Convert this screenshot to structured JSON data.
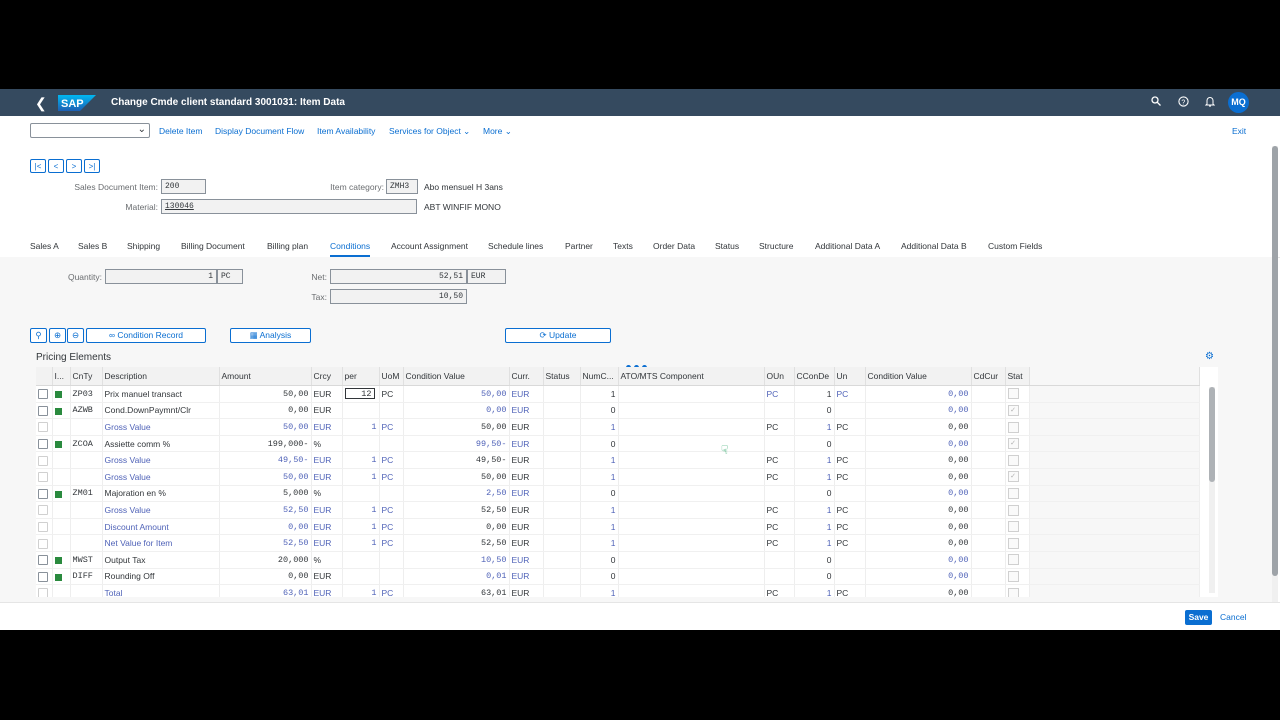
{
  "shell": {
    "logo_text": "SAP",
    "title": "Change Cmde client standard 3001031: Item Data",
    "avatar": "MQ",
    "icons": [
      "back-icon",
      "search-icon",
      "help-icon",
      "notifications-icon"
    ]
  },
  "toolbar": {
    "variant_value": "",
    "links": [
      "Delete Item",
      "Display Document Flow",
      "Item Availability",
      "Services for Object",
      "More"
    ],
    "exit": "Exit"
  },
  "nav_buttons": [
    "|<",
    "<",
    ">",
    ">|"
  ],
  "header": {
    "sales_doc_item_label": "Sales Document Item:",
    "sales_doc_item_value": "200",
    "item_category_label": "Item category:",
    "item_category_value": "ZMH3",
    "item_category_text": "Abo mensuel H 3ans",
    "material_label": "Material:",
    "material_value": "130046",
    "material_text": "ABT WINFIF MONO"
  },
  "tabs": [
    "Sales A",
    "Sales B",
    "Shipping",
    "Billing Document",
    "Billing plan",
    "Conditions",
    "Account Assignment",
    "Schedule lines",
    "Partner",
    "Texts",
    "Order Data",
    "Status",
    "Structure",
    "Additional Data A",
    "Additional Data B",
    "Custom Fields"
  ],
  "active_tab": "Conditions",
  "conditions": {
    "quantity_label": "Quantity:",
    "quantity_value": "1",
    "quantity_unit": "PC",
    "net_label": "Net:",
    "net_value": "52,51",
    "net_currency": "EUR",
    "tax_label": "Tax:",
    "tax_value": "10,50",
    "buttons": {
      "condition_record": "Condition Record",
      "analysis": "Analysis",
      "update": "Update"
    }
  },
  "pricing": {
    "title": "Pricing Elements",
    "columns": [
      "I...",
      "CnTy",
      "Description",
      "Amount",
      "Crcy",
      "per",
      "UoM",
      "Condition Value",
      "Curr.",
      "Status",
      "NumC...",
      "ATO/MTS Component",
      "OUn",
      "CConDe",
      "Un",
      "Condition Value",
      "CdCur",
      "Stat"
    ],
    "rows": [
      {
        "active": true,
        "cnty": "ZP03",
        "desc": "Prix manuel transact",
        "amount": "50,00",
        "crcy": "EUR",
        "per": "12",
        "uom": "PC",
        "cval": "50,00",
        "curr": "EUR",
        "numc": "1",
        "oun": "PC",
        "ccon": "1",
        "un": "PC",
        "cval2": "0,00",
        "stat": false,
        "sub": false
      },
      {
        "active": true,
        "cnty": "AZWB",
        "desc": "Cond.DownPaymnt/Clr",
        "amount": "0,00",
        "crcy": "EUR",
        "per": "",
        "uom": "",
        "cval": "0,00",
        "curr": "EUR",
        "numc": "0",
        "oun": "",
        "ccon": "0",
        "un": "",
        "cval2": "0,00",
        "stat": true,
        "sub": false
      },
      {
        "active": false,
        "cnty": "",
        "desc": "Gross Value",
        "amount": "50,00",
        "crcy": "EUR",
        "per": "1",
        "uom": "PC",
        "cval": "50,00",
        "curr": "EUR",
        "numc": "1",
        "oun": "PC",
        "ccon": "1",
        "un": "PC",
        "cval2": "0,00",
        "stat": false,
        "sub": true
      },
      {
        "active": true,
        "cnty": "ZCOA",
        "desc": "Assiette comm %",
        "amount": "199,000-",
        "crcy": "%",
        "per": "",
        "uom": "",
        "cval": "99,50-",
        "curr": "EUR",
        "numc": "0",
        "oun": "",
        "ccon": "0",
        "un": "",
        "cval2": "0,00",
        "stat": true,
        "sub": false
      },
      {
        "active": false,
        "cnty": "",
        "desc": "Gross Value",
        "amount": "49,50-",
        "crcy": "EUR",
        "per": "1",
        "uom": "PC",
        "cval": "49,50-",
        "curr": "EUR",
        "numc": "1",
        "oun": "PC",
        "ccon": "1",
        "un": "PC",
        "cval2": "0,00",
        "stat": false,
        "sub": true
      },
      {
        "active": false,
        "cnty": "",
        "desc": "Gross Value",
        "amount": "50,00",
        "crcy": "EUR",
        "per": "1",
        "uom": "PC",
        "cval": "50,00",
        "curr": "EUR",
        "numc": "1",
        "oun": "PC",
        "ccon": "1",
        "un": "PC",
        "cval2": "0,00",
        "stat": true,
        "sub": true
      },
      {
        "active": true,
        "cnty": "ZM01",
        "desc": "Majoration en %",
        "amount": "5,000",
        "crcy": "%",
        "per": "",
        "uom": "",
        "cval": "2,50",
        "curr": "EUR",
        "numc": "0",
        "oun": "",
        "ccon": "0",
        "un": "",
        "cval2": "0,00",
        "stat": false,
        "sub": false
      },
      {
        "active": false,
        "cnty": "",
        "desc": "Gross Value",
        "amount": "52,50",
        "crcy": "EUR",
        "per": "1",
        "uom": "PC",
        "cval": "52,50",
        "curr": "EUR",
        "numc": "1",
        "oun": "PC",
        "ccon": "1",
        "un": "PC",
        "cval2": "0,00",
        "stat": false,
        "sub": true
      },
      {
        "active": false,
        "cnty": "",
        "desc": "Discount Amount",
        "amount": "0,00",
        "crcy": "EUR",
        "per": "1",
        "uom": "PC",
        "cval": "0,00",
        "curr": "EUR",
        "numc": "1",
        "oun": "PC",
        "ccon": "1",
        "un": "PC",
        "cval2": "0,00",
        "stat": false,
        "sub": true
      },
      {
        "active": false,
        "cnty": "",
        "desc": "Net Value for Item",
        "amount": "52,50",
        "crcy": "EUR",
        "per": "1",
        "uom": "PC",
        "cval": "52,50",
        "curr": "EUR",
        "numc": "1",
        "oun": "PC",
        "ccon": "1",
        "un": "PC",
        "cval2": "0,00",
        "stat": false,
        "sub": true
      },
      {
        "active": true,
        "cnty": "MWST",
        "desc": "Output Tax",
        "amount": "20,000",
        "crcy": "%",
        "per": "",
        "uom": "",
        "cval": "10,50",
        "curr": "EUR",
        "numc": "0",
        "oun": "",
        "ccon": "0",
        "un": "",
        "cval2": "0,00",
        "stat": false,
        "sub": false
      },
      {
        "active": true,
        "cnty": "DIFF",
        "desc": "Rounding Off",
        "amount": "0,00",
        "crcy": "EUR",
        "per": "",
        "uom": "",
        "cval": "0,01",
        "curr": "EUR",
        "numc": "0",
        "oun": "",
        "ccon": "0",
        "un": "",
        "cval2": "0,00",
        "stat": false,
        "sub": false
      },
      {
        "active": false,
        "cnty": "",
        "desc": "Total",
        "amount": "63,01",
        "crcy": "EUR",
        "per": "1",
        "uom": "PC",
        "cval": "63,01",
        "curr": "EUR",
        "numc": "1",
        "oun": "PC",
        "ccon": "1",
        "un": "PC",
        "cval2": "0,00",
        "stat": false,
        "sub": true
      }
    ]
  },
  "footer": {
    "save": "Save",
    "cancel": "Cancel"
  },
  "colors": {
    "shell": "#354a5f",
    "accent": "#0a6ed1",
    "active_square": "#2a8a3e"
  }
}
